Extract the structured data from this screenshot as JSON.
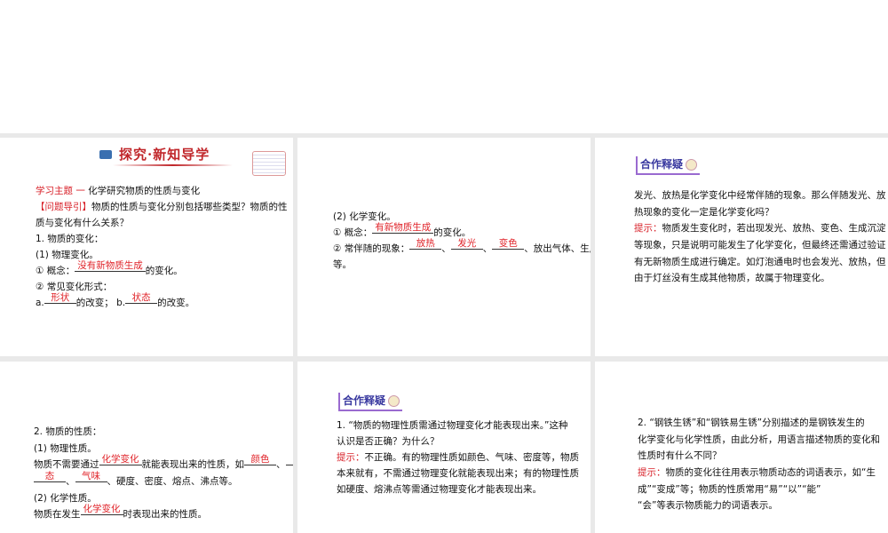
{
  "banner": {
    "title": "探究·新知导学"
  },
  "section_header": "合作释疑",
  "slides": [
    {
      "lines": [
        [
          {
            "s": "h",
            "text": "学习主题 一"
          },
          {
            "s": "t",
            "text": "  化学研究物质的性质与变化"
          }
        ],
        [
          {
            "s": "h",
            "text": "【问题导引】"
          },
          {
            "s": "t",
            "text": "物质的性质与变化分别包括哪些类型？物质的性"
          }
        ],
        [
          {
            "s": "t",
            "text": "质与变化有什么关系？"
          }
        ],
        [
          {
            "s": "t",
            "text": "1. 物质的变化："
          }
        ],
        [
          {
            "s": "t",
            "text": "(1) 物理变化。"
          }
        ],
        [
          {
            "s": "t",
            "text": "① 概念："
          },
          {
            "s": "a",
            "text": "没有新物质生成"
          },
          {
            "s": "t",
            "text": "的变化。"
          }
        ],
        [
          {
            "s": "t",
            "text": "② 常见变化形式："
          }
        ],
        [
          {
            "s": "t",
            "text": "a."
          },
          {
            "s": "a",
            "text": "形状"
          },
          {
            "s": "t",
            "text": "的改变； b."
          },
          {
            "s": "a",
            "text": "状态"
          },
          {
            "s": "t",
            "text": "的改变。"
          }
        ]
      ]
    },
    {
      "lines": [
        [
          {
            "s": "t",
            "text": "(2) 化学变化。"
          }
        ],
        [
          {
            "s": "t",
            "text": "① 概念："
          },
          {
            "s": "a",
            "text": "有新物质生成"
          },
          {
            "s": "t",
            "text": "的变化。"
          }
        ],
        [
          {
            "s": "t",
            "text": "② 常伴随的现象："
          },
          {
            "s": "a",
            "text": "放热"
          },
          {
            "s": "t",
            "text": "、"
          },
          {
            "s": "a",
            "text": "发光"
          },
          {
            "s": "t",
            "text": "、"
          },
          {
            "s": "a",
            "text": "变色"
          },
          {
            "s": "t",
            "text": "、放出气体、生成沉淀"
          }
        ],
        [
          {
            "s": "t",
            "text": "等。"
          }
        ]
      ]
    },
    {
      "header": true,
      "lines": [
        [
          {
            "s": "t",
            "text": "发光、放热是化学变化中经常伴随的现象。那么伴随发光、放"
          }
        ],
        [
          {
            "s": "t",
            "text": "热现象的变化一定是化学变化吗？"
          }
        ],
        [
          {
            "s": "h",
            "text": "提示："
          },
          {
            "s": "t",
            "text": "物质发生变化时，若出现发光、放热、变色、生成沉淀"
          }
        ],
        [
          {
            "s": "t",
            "text": "等现象，只是说明可能发生了化学变化，但最终还需通过验证"
          }
        ],
        [
          {
            "s": "t",
            "text": "有无新物质生成进行确定。如灯泡通电时也会发光、放热，但"
          }
        ],
        [
          {
            "s": "t",
            "text": "由于灯丝没有生成其他物质，故属于物理变化。"
          }
        ]
      ]
    },
    {
      "lines": [
        [
          {
            "s": "t",
            "text": "2. 物质的性质："
          }
        ],
        [
          {
            "s": "t",
            "text": "(1) 物理性质。"
          }
        ],
        [
          {
            "s": "t",
            "text": "物质不需要通过"
          },
          {
            "s": "a",
            "text": "化学变化"
          },
          {
            "s": "t",
            "text": "就能表现出来的性质，如"
          },
          {
            "s": "a",
            "text": "颜色"
          },
          {
            "s": "t",
            "text": "、"
          },
          {
            "s": "a",
            "text": "状"
          }
        ],
        [
          {
            "s": "a",
            "text": "态"
          },
          {
            "s": "t",
            "text": "、"
          },
          {
            "s": "a",
            "text": "气味"
          },
          {
            "s": "t",
            "text": "、硬度、密度、熔点、沸点等。"
          }
        ],
        [
          {
            "s": "t",
            "text": "(2) 化学性质。"
          }
        ],
        [
          {
            "s": "t",
            "text": "物质在发生"
          },
          {
            "s": "a",
            "text": "化学变化"
          },
          {
            "s": "t",
            "text": "时表现出来的性质。"
          }
        ]
      ]
    },
    {
      "header": true,
      "lines": [
        [
          {
            "s": "t",
            "text": "1. “物质的物理性质需通过物理变化才能表现出来。”这种"
          }
        ],
        [
          {
            "s": "t",
            "text": "认识是否正确？为什么？"
          }
        ],
        [
          {
            "s": "h",
            "text": "提示："
          },
          {
            "s": "t",
            "text": "不正确。有的物理性质如颜色、气味、密度等，物质"
          }
        ],
        [
          {
            "s": "t",
            "text": "本来就有，不需通过物理变化就能表现出来；有的物理性质"
          }
        ],
        [
          {
            "s": "t",
            "text": "如硬度、熔沸点等需通过物理变化才能表现出来。"
          }
        ]
      ]
    },
    {
      "lines": [
        [
          {
            "s": "t",
            "text": "2. “钢铁生锈”和“钢铁易生锈”分别描述的是钢铁发生的"
          }
        ],
        [
          {
            "s": "t",
            "text": "化学变化与化学性质，由此分析，用语言描述物质的变化和"
          }
        ],
        [
          {
            "s": "t",
            "text": "性质时有什么不同？"
          }
        ],
        [
          {
            "s": "h",
            "text": "提示："
          },
          {
            "s": "t",
            "text": "物质的变化往往用表示物质动态的词语表示，如“生"
          }
        ],
        [
          {
            "s": "t",
            "text": "成”“变成”等；物质的性质常用“易”“以”“能”"
          }
        ],
        [
          {
            "s": "t",
            "text": "“会”等表示物质能力的词语表示。"
          }
        ]
      ]
    }
  ]
}
